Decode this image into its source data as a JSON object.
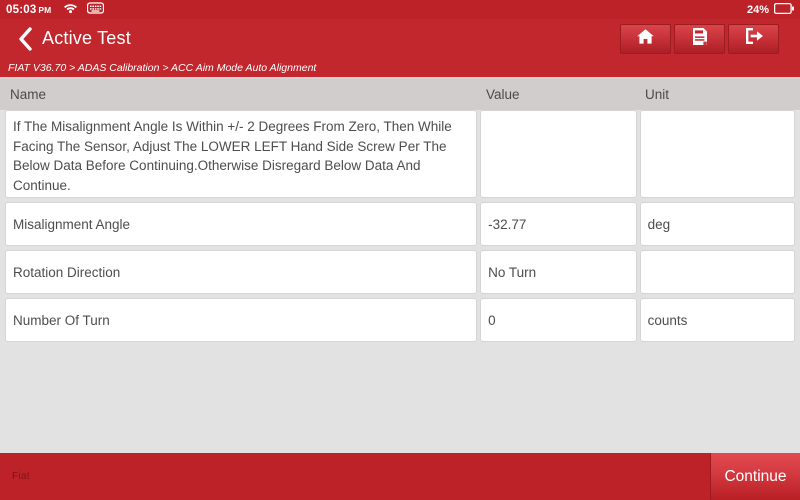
{
  "statusbar": {
    "time": "05:03",
    "ampm": "PM",
    "wifi_icon": "wifi-icon",
    "keyboard_icon": "keyboard-icon",
    "battery_percent": "24%",
    "battery_icon": "battery-icon"
  },
  "titlebar": {
    "back_icon": "back-chevron-icon",
    "title": "Active Test",
    "buttons": [
      {
        "name": "home-button",
        "icon": "home-icon"
      },
      {
        "name": "report-button",
        "icon": "report-icon"
      },
      {
        "name": "exit-button",
        "icon": "exit-icon"
      }
    ]
  },
  "breadcrumb": {
    "text": "FIAT V36.70 > ADAS Calibration > ACC Aim Mode Auto Alignment"
  },
  "table": {
    "headers": {
      "name": "Name",
      "value": "Value",
      "unit": "Unit"
    },
    "rows": [
      {
        "name": "If The Misalignment Angle Is Within +/- 2 Degrees From Zero, Then While Facing The Sensor, Adjust The LOWER LEFT Hand Side Screw Per The Below Data Before Continuing.Otherwise Disregard Below Data And Continue.",
        "value": "",
        "unit": ""
      },
      {
        "name": "Misalignment Angle",
        "value": "-32.77",
        "unit": "deg"
      },
      {
        "name": "Rotation Direction",
        "value": "No Turn",
        "unit": ""
      },
      {
        "name": "Number Of Turn",
        "value": "0",
        "unit": "counts"
      }
    ]
  },
  "bottombar": {
    "brand": "Fiat",
    "continue_label": "Continue"
  },
  "colors": {
    "brand_red": "#c1272d",
    "status_red": "#bd2228",
    "background_gray": "#e2e2e2",
    "header_gray": "#d2cdcd"
  }
}
